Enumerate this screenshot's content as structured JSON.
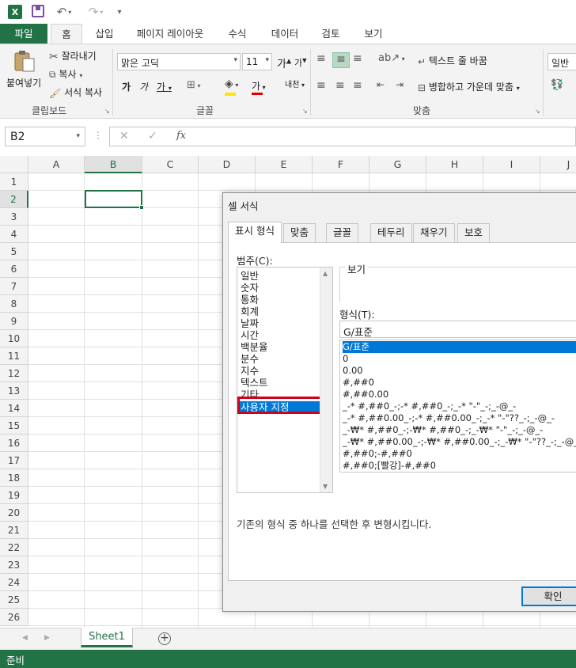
{
  "quick_access": {
    "logo_letter": "X"
  },
  "tabs": {
    "file": "파일",
    "home": "홈",
    "insert": "삽입",
    "page_layout": "페이지 레이아웃",
    "formulas": "수식",
    "data": "데이터",
    "review": "검토",
    "view": "보기"
  },
  "ribbon": {
    "clipboard": {
      "label": "클립보드",
      "paste": "붙여넣기",
      "cut": "잘라내기",
      "copy": "복사",
      "format_painter": "서식 복사"
    },
    "font": {
      "label": "글꼴",
      "font_name": "맑은 고딕",
      "font_size": "11",
      "grow": "가",
      "shrink": "가",
      "bold": "가",
      "italic": "가",
      "underline": "가",
      "font_color_glyph": "가",
      "phonetic": "내천"
    },
    "alignment": {
      "label": "맞춤",
      "wrap_text": "텍스트 줄 바꿈",
      "merge_center": "병합하고 가운데 맞춤"
    },
    "number": {
      "format": "일반"
    }
  },
  "formula_bar": {
    "name_box": "B2",
    "fx": "fx",
    "formula": ""
  },
  "grid": {
    "columns": [
      "A",
      "B",
      "C",
      "D",
      "E",
      "F",
      "G",
      "H",
      "I",
      "J"
    ],
    "rows": [
      "1",
      "2",
      "3",
      "4",
      "5",
      "6",
      "7",
      "8",
      "9",
      "10",
      "11",
      "12",
      "13",
      "14",
      "15",
      "16",
      "17",
      "18",
      "19",
      "20",
      "21",
      "22",
      "23",
      "24",
      "25",
      "26"
    ],
    "selected_column": "B",
    "selected_row": "2"
  },
  "sheets": {
    "active": "Sheet1"
  },
  "status": {
    "text": "준비"
  },
  "dialog": {
    "title": "셀 서식",
    "tabs": [
      "표시 형식",
      "맞춤",
      "글꼴",
      "테두리",
      "채우기",
      "보호"
    ],
    "category_label": "범주(C):",
    "categories": [
      "일반",
      "숫자",
      "통화",
      "회계",
      "날짜",
      "시간",
      "백분율",
      "분수",
      "지수",
      "텍스트",
      "기타",
      "사용자 지정"
    ],
    "selected_category": "사용자 지정",
    "preview_label": "보기",
    "format_label": "형식(T):",
    "format_value": "G/표준",
    "formats": [
      "G/표준",
      "0",
      "0.00",
      "#,##0",
      "#,##0.00",
      "_-* #,##0_-;-* #,##0_-;_-* \"-\"_-;_-@_-",
      "_-* #,##0.00_-;-* #,##0.00_-;_-* \"-\"??_-;_-@_-",
      "_-₩* #,##0_-;-₩* #,##0_-;_-₩* \"-\"_-;_-@_-",
      "_-₩* #,##0.00_-;-₩* #,##0.00_-;_-₩* \"-\"??_-;_-@_-",
      "#,##0;-#,##0",
      "#,##0;[빨강]-#,##0"
    ],
    "hint": "기존의 형식 중 하나를 선택한 후 변형시킵니다.",
    "ok": "확인"
  }
}
